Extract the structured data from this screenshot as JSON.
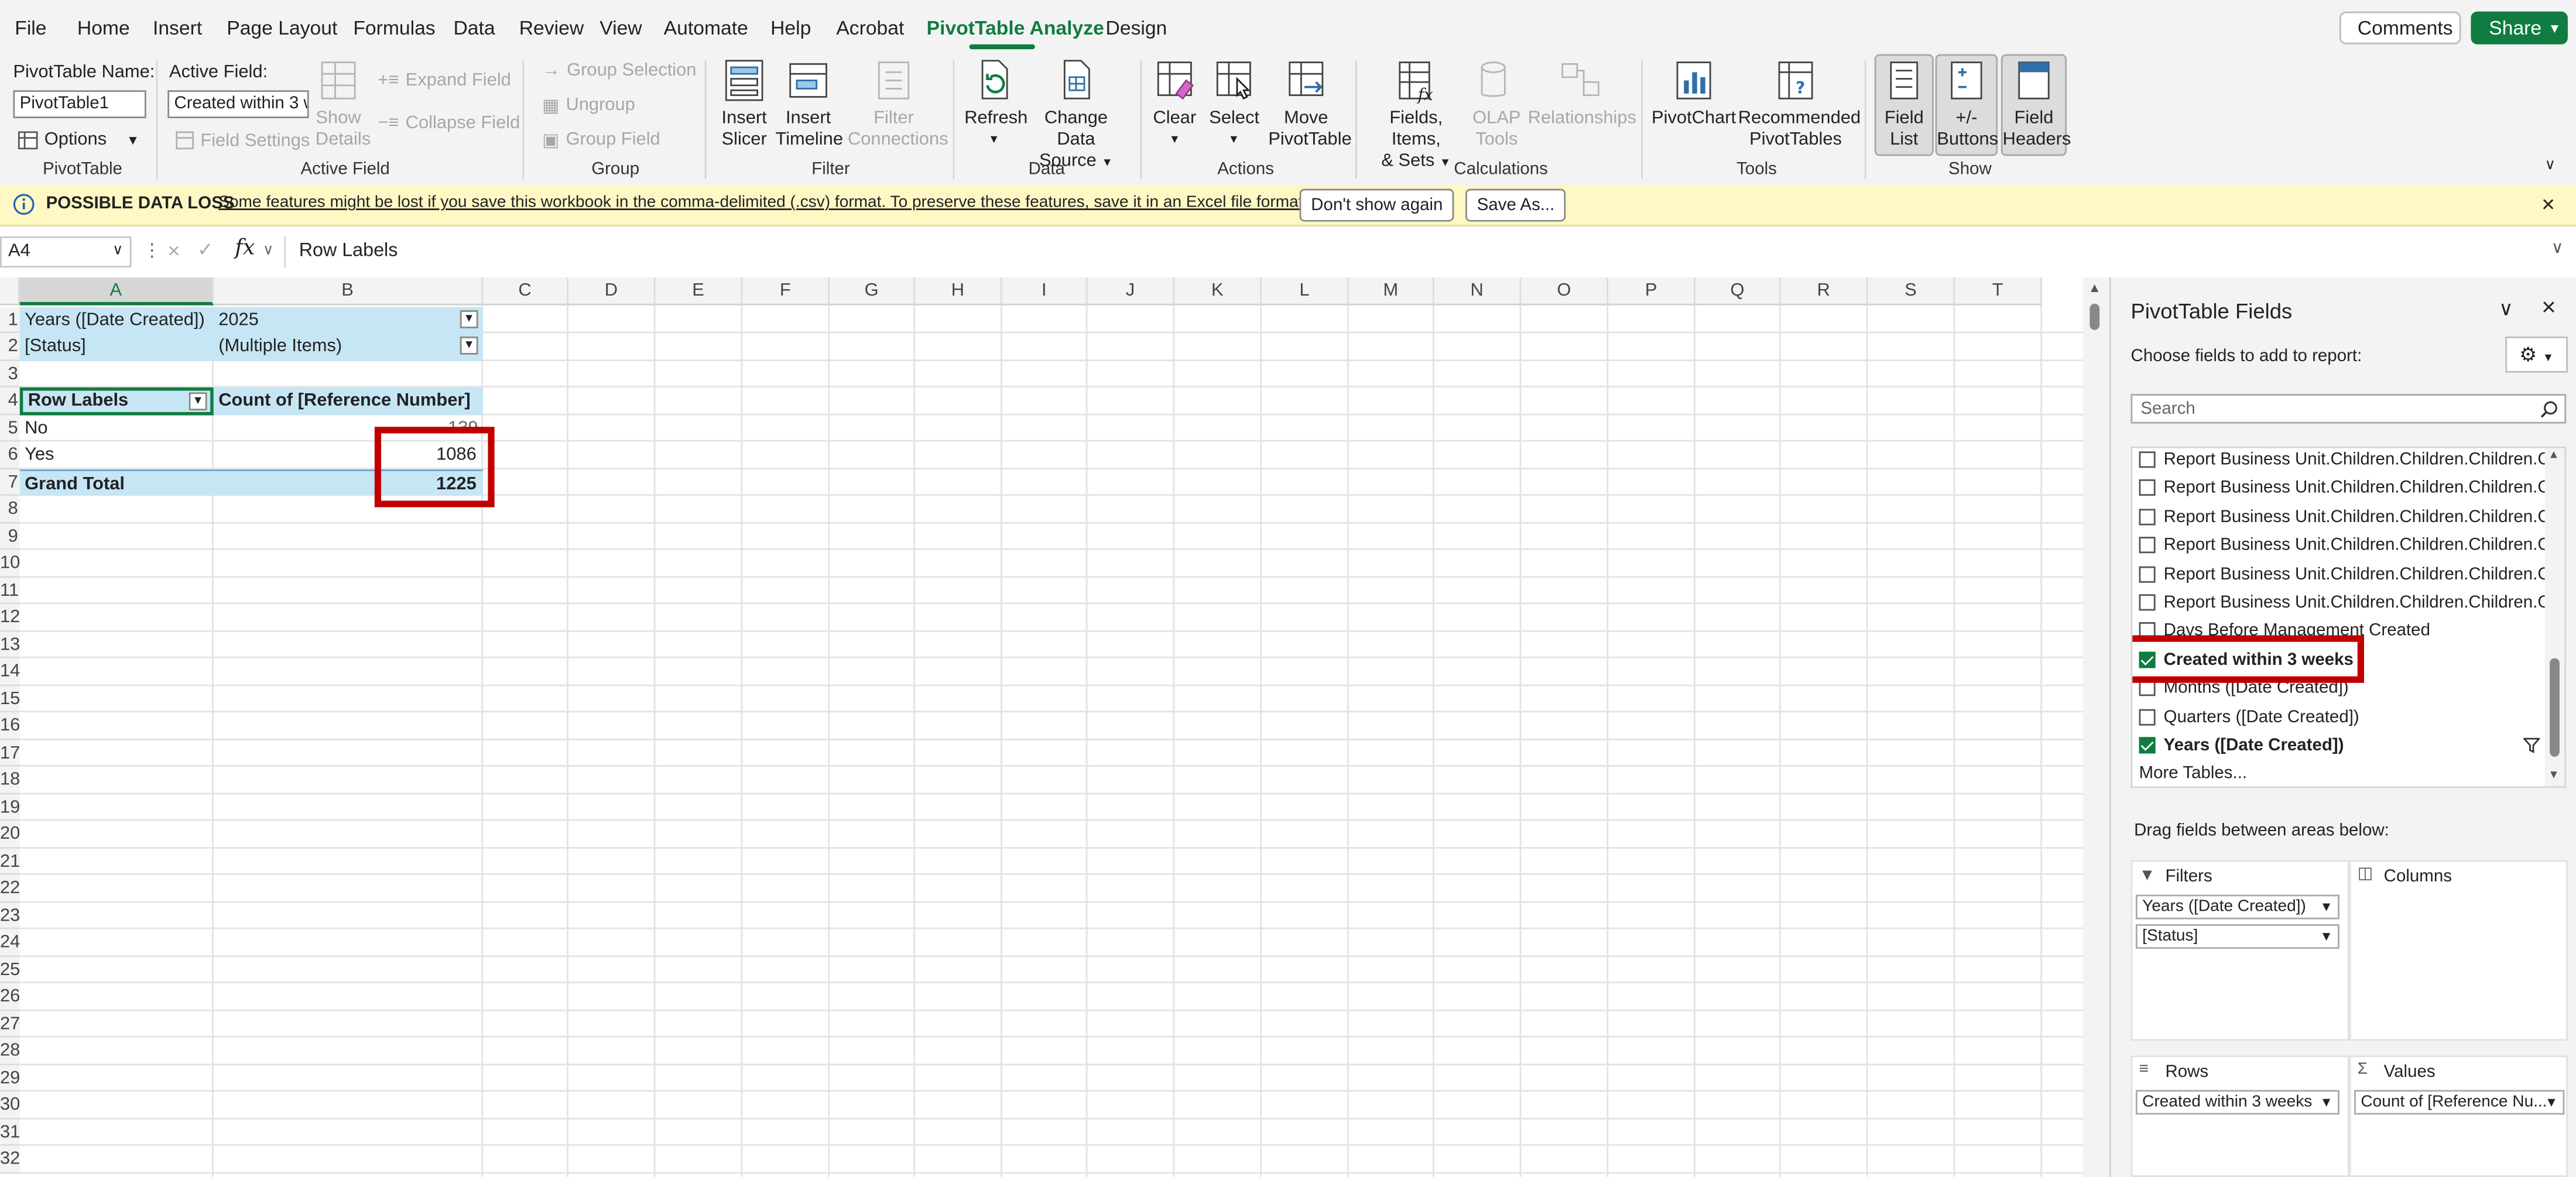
{
  "menu": {
    "tabs": [
      "File",
      "Home",
      "Insert",
      "Page Layout",
      "Formulas",
      "Data",
      "Review",
      "View",
      "Automate",
      "Help",
      "Acrobat",
      "PivotTable Analyze",
      "Design"
    ],
    "comments": "Comments",
    "share": "Share"
  },
  "ribbon": {
    "pivottable_name_label": "PivotTable Name:",
    "pivottable_name_value": "PivotTable1",
    "options": "Options",
    "group_pivottable": "PivotTable",
    "active_field_label": "Active Field:",
    "active_field_value": "Created within 3 w",
    "field_settings": "Field Settings",
    "show_details": [
      "Show",
      "Details"
    ],
    "expand_field": "Expand Field",
    "collapse_field": "Collapse Field",
    "group_active_field": "Active Field",
    "group_selection": "Group Selection",
    "ungroup": "Ungroup",
    "group_field": "Group Field",
    "group_group": "Group",
    "insert_slicer": [
      "Insert",
      "Slicer"
    ],
    "insert_timeline": [
      "Insert",
      "Timeline"
    ],
    "filter_connections": [
      "Filter",
      "Connections"
    ],
    "group_filter": "Filter",
    "refresh": "Refresh",
    "change_data_source": [
      "Change Data",
      "Source"
    ],
    "group_data": "Data",
    "clear": "Clear",
    "select": "Select",
    "move_pivottable": [
      "Move",
      "PivotTable"
    ],
    "group_actions": "Actions",
    "fields_items_sets": [
      "Fields, Items,",
      "& Sets"
    ],
    "olap_tools": [
      "OLAP",
      "Tools"
    ],
    "relationships": "Relationships",
    "group_calculations": "Calculations",
    "pivotchart": "PivotChart",
    "recommended_pivottables": [
      "Recommended",
      "PivotTables"
    ],
    "group_tools": "Tools",
    "field_list": [
      "Field",
      "List"
    ],
    "plus_minus_buttons": [
      "+/-",
      "Buttons"
    ],
    "field_headers": [
      "Field",
      "Headers"
    ],
    "group_show": "Show"
  },
  "notification": {
    "title": "POSSIBLE DATA LOSS",
    "message": "Some features might be lost if you save this workbook in the comma-delimited (.csv) format. To preserve these features, save it in an Excel file format.",
    "dont_show": "Don't show again",
    "save_as": "Save As..."
  },
  "formula_bar": {
    "name_box": "A4",
    "fx": "fx",
    "content": "Row Labels"
  },
  "grid": {
    "columns": [
      "A",
      "B",
      "C",
      "D",
      "E",
      "F",
      "G",
      "H",
      "I",
      "J",
      "K",
      "L",
      "M",
      "N",
      "O",
      "P",
      "Q",
      "R",
      "S",
      "T"
    ],
    "row_numbers": [
      "1",
      "2",
      "3",
      "4",
      "5",
      "6",
      "7",
      "8",
      "9",
      "10",
      "11",
      "12",
      "13",
      "14",
      "15",
      "16",
      "17",
      "18",
      "19",
      "20",
      "21",
      "22",
      "23",
      "24",
      "25",
      "26",
      "27",
      "28",
      "29",
      "30",
      "31",
      "32"
    ],
    "pivot": {
      "filter1_label": "Years ([Date Created])",
      "filter1_value": "2025",
      "filter2_label": "[Status]",
      "filter2_value": "(Multiple Items)",
      "row_labels_header": "Row Labels",
      "values_header": "Count of [Reference Number]",
      "rows": [
        {
          "label": "No",
          "value": "139"
        },
        {
          "label": "Yes",
          "value": "1086"
        }
      ],
      "grand_total_label": "Grand Total",
      "grand_total_value": "1225"
    }
  },
  "pane": {
    "title": "PivotTable Fields",
    "subtitle": "Choose fields to add to report:",
    "search_placeholder": "Search",
    "fields": [
      {
        "label": "Report Business Unit.Children.Children.Children.C...",
        "checked": false
      },
      {
        "label": "Report Business Unit.Children.Children.Children.C...",
        "checked": false
      },
      {
        "label": "Report Business Unit.Children.Children.Children.C...",
        "checked": false
      },
      {
        "label": "Report Business Unit.Children.Children.Children.C...",
        "checked": false
      },
      {
        "label": "Report Business Unit.Children.Children.Children.C...",
        "checked": false
      },
      {
        "label": "Report Business Unit.Children.Children.Children.C...",
        "checked": false
      },
      {
        "label": "Days Before Management Created",
        "checked": false
      },
      {
        "label": "Created within 3 weeks",
        "checked": true
      },
      {
        "label": "Months ([Date Created])",
        "checked": false
      },
      {
        "label": "Quarters ([Date Created])",
        "checked": false
      },
      {
        "label": "Years ([Date Created])",
        "checked": true
      }
    ],
    "more_tables": "More Tables...",
    "drag_hint": "Drag fields between areas below:",
    "filters_label": "Filters",
    "columns_label": "Columns",
    "rows_label": "Rows",
    "values_label": "Values",
    "filter_chips": [
      "Years ([Date Created])",
      "[Status]"
    ],
    "row_chips": [
      "Created within 3 weeks"
    ],
    "value_chips": [
      "Count of [Reference Nu..."
    ]
  },
  "colors": {
    "accent": "#107c41",
    "pivot_highlight": "#c7e6f5",
    "annotation_red": "#c00000",
    "notify_bg": "#fff8c5"
  }
}
